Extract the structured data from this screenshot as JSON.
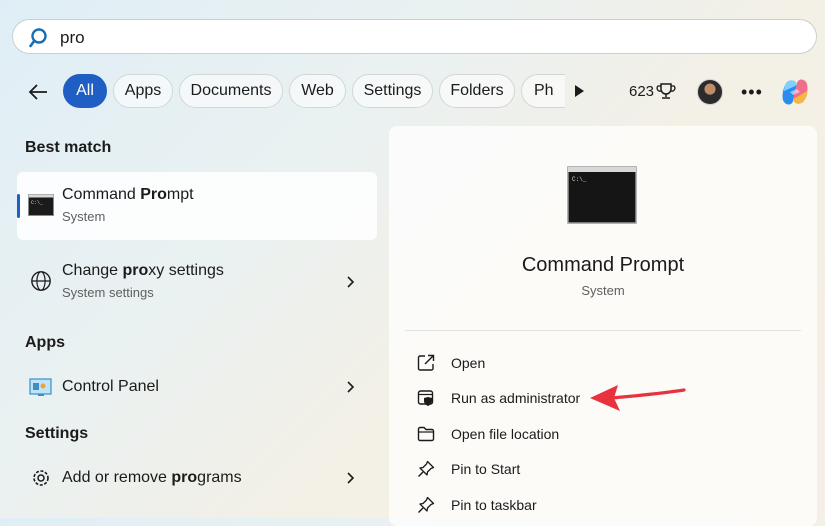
{
  "search": {
    "query": "pro"
  },
  "filters": {
    "items": [
      {
        "label": "All",
        "active": true
      },
      {
        "label": "Apps",
        "active": false
      },
      {
        "label": "Documents",
        "active": false
      },
      {
        "label": "Web",
        "active": false
      },
      {
        "label": "Settings",
        "active": false
      },
      {
        "label": "Folders",
        "active": false
      },
      {
        "label": "Ph",
        "active": false
      }
    ],
    "points": "623"
  },
  "results": {
    "best_match_heading": "Best match",
    "best_match": {
      "title_prefix": "Command ",
      "title_bold": "Pro",
      "title_suffix": "mpt",
      "subtitle": "System",
      "icon": "terminal-icon"
    },
    "proxy": {
      "title_prefix": "Change ",
      "title_bold": "pro",
      "title_suffix": "xy settings",
      "subtitle": "System settings",
      "icon": "globe-icon"
    },
    "apps_heading": "Apps",
    "control_panel": {
      "title": "Control Panel",
      "icon": "control-panel-icon"
    },
    "settings_heading": "Settings",
    "add_remove": {
      "title_prefix": "Add or remove ",
      "title_bold": "pro",
      "title_suffix": "grams",
      "icon": "gear-icon"
    }
  },
  "detail": {
    "title": "Command Prompt",
    "subtitle": "System",
    "actions": [
      {
        "label": "Open",
        "icon": "open-external-icon"
      },
      {
        "label": "Run as administrator",
        "icon": "shield-admin-icon"
      },
      {
        "label": "Open file location",
        "icon": "folder-icon"
      },
      {
        "label": "Pin to Start",
        "icon": "pin-icon"
      },
      {
        "label": "Pin to taskbar",
        "icon": "pin-icon"
      }
    ]
  },
  "colors": {
    "accent": "#1f5fc4",
    "annotation_arrow": "#e8333f"
  }
}
